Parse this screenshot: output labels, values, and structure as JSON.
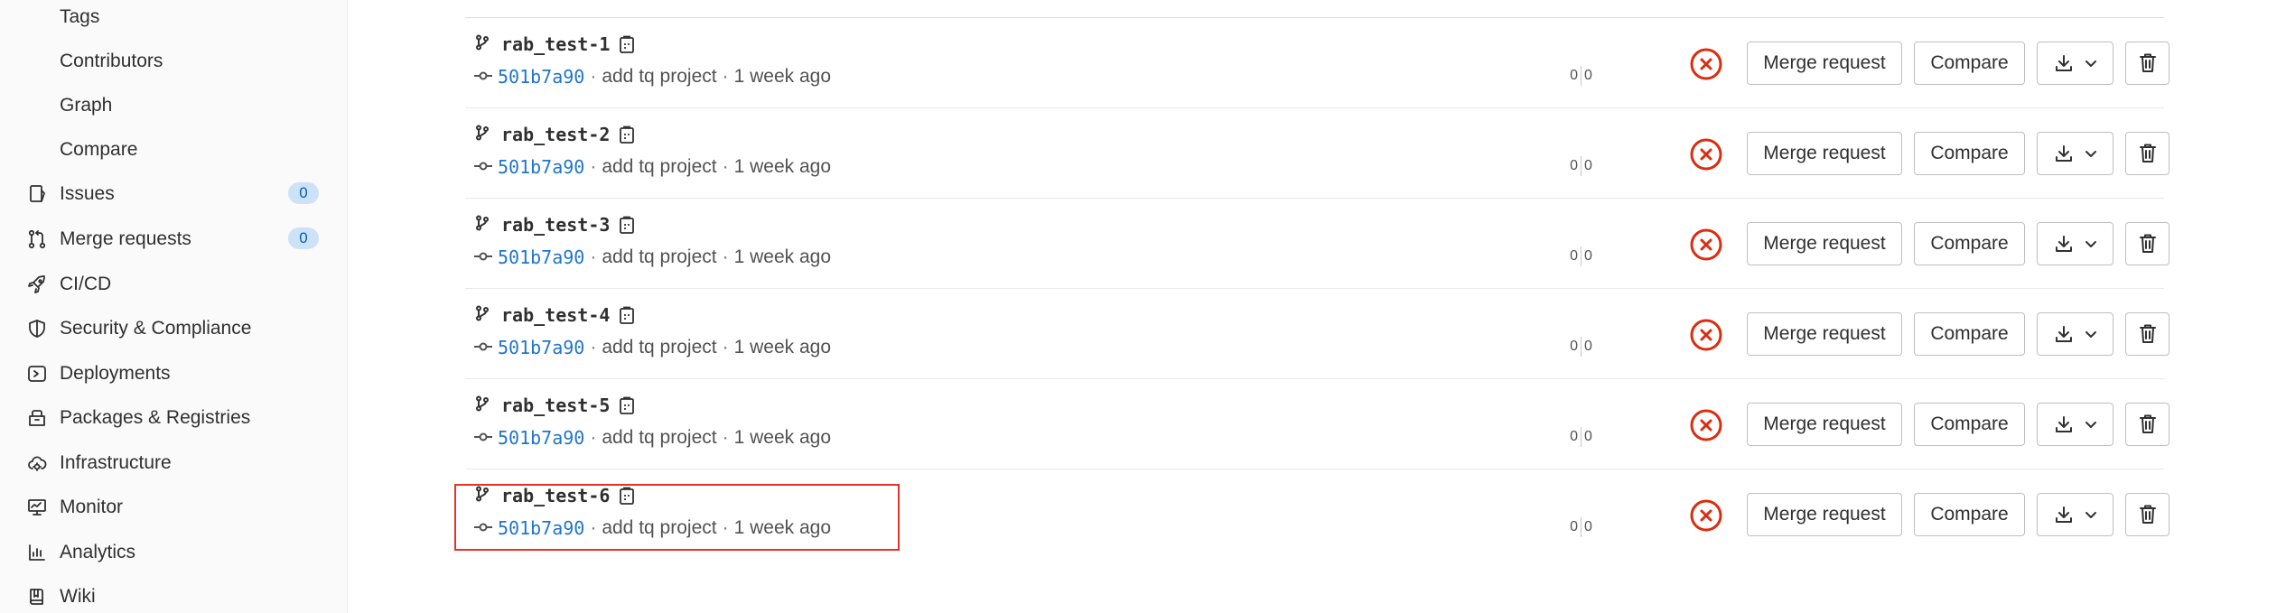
{
  "sidebar": {
    "items": [
      {
        "label": "Tags",
        "level": "sub"
      },
      {
        "label": "Contributors",
        "level": "sub"
      },
      {
        "label": "Graph",
        "level": "sub"
      },
      {
        "label": "Compare",
        "level": "sub"
      },
      {
        "label": "Issues",
        "level": "top",
        "icon": "issues-icon",
        "badge": "0"
      },
      {
        "label": "Merge requests",
        "level": "top",
        "icon": "merge-request-icon",
        "badge": "0"
      },
      {
        "label": "CI/CD",
        "level": "top",
        "icon": "rocket-icon"
      },
      {
        "label": "Security & Compliance",
        "level": "top",
        "icon": "shield-icon"
      },
      {
        "label": "Deployments",
        "level": "top",
        "icon": "deployments-icon"
      },
      {
        "label": "Packages & Registries",
        "level": "top",
        "icon": "package-icon"
      },
      {
        "label": "Infrastructure",
        "level": "top",
        "icon": "cloud-gear-icon"
      },
      {
        "label": "Monitor",
        "level": "top",
        "icon": "monitor-icon"
      },
      {
        "label": "Analytics",
        "level": "top",
        "icon": "chart-icon"
      },
      {
        "label": "Wiki",
        "level": "top",
        "icon": "book-icon"
      }
    ]
  },
  "branches": [
    {
      "name": "rab_test-1",
      "sha": "501b7a90",
      "message": "add tq project",
      "time": "1 week ago",
      "behind": "0",
      "ahead": "0"
    },
    {
      "name": "rab_test-2",
      "sha": "501b7a90",
      "message": "add tq project",
      "time": "1 week ago",
      "behind": "0",
      "ahead": "0"
    },
    {
      "name": "rab_test-3",
      "sha": "501b7a90",
      "message": "add tq project",
      "time": "1 week ago",
      "behind": "0",
      "ahead": "0"
    },
    {
      "name": "rab_test-4",
      "sha": "501b7a90",
      "message": "add tq project",
      "time": "1 week ago",
      "behind": "0",
      "ahead": "0"
    },
    {
      "name": "rab_test-5",
      "sha": "501b7a90",
      "message": "add tq project",
      "time": "1 week ago",
      "behind": "0",
      "ahead": "0"
    },
    {
      "name": "rab_test-6",
      "sha": "501b7a90",
      "message": "add tq project",
      "time": "1 week ago",
      "behind": "0",
      "ahead": "0"
    }
  ],
  "actions": {
    "merge_request_label": "Merge request",
    "compare_label": "Compare",
    "separator": "·"
  },
  "colors": {
    "status_failed": "#dd2b0e",
    "link": "#1f75cb",
    "highlight": "#e5312c",
    "badge_bg": "#cbe2f9"
  },
  "highlighted_branch": "rab_test-6"
}
